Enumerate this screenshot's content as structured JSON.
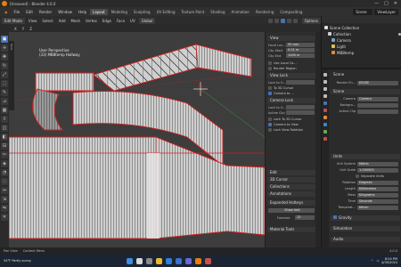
{
  "titlebar": {
    "title": "[Unsaved] - Blender 4.0.0",
    "min": "—",
    "max": "□",
    "close": "✕"
  },
  "menu": {
    "items": [
      "File",
      "Edit",
      "Render",
      "Window",
      "Help"
    ]
  },
  "workspaces": {
    "tabs": [
      "Layout",
      "Modeling",
      "Sculpting",
      "UV Editing",
      "Texture Paint",
      "Shading",
      "Animation",
      "Rendering",
      "Compositing",
      "Geometry Nodes",
      "Scripting"
    ],
    "active": "Layout"
  },
  "scene": {
    "name": "Scene",
    "view_layer": "ViewLayer"
  },
  "viewport_header": {
    "mode": "Edit Mode",
    "menus": [
      "View",
      "Select",
      "Add",
      "Mesh",
      "Vertex",
      "Edge",
      "Face",
      "UV"
    ],
    "orientation": "Global",
    "options": "Options"
  },
  "viewport_header2": {
    "items": [
      "X",
      "Y",
      "Z"
    ]
  },
  "tools_tab": "Tools",
  "viewport": {
    "view_name": "User Perspective",
    "object_name": "(33) MB8temp Hallway"
  },
  "toolbar": {
    "icons": [
      "select-box-icon",
      "cursor-icon",
      "move-icon",
      "rotate-icon",
      "scale-icon",
      "transform-icon",
      "annotate-icon",
      "measure-icon",
      "add-cube-icon",
      "extrude-icon",
      "inset-icon",
      "bevel-icon",
      "loopcut-icon",
      "knife-icon",
      "polybuild-icon",
      "spin-icon",
      "smooth-icon",
      "slide-icon",
      "shrink-icon",
      "shear-icon",
      "rip-icon"
    ]
  },
  "npanel": {
    "view_section": "View",
    "focal_length": {
      "label": "Focal Len...",
      "value": "50 mm"
    },
    "clip_start": {
      "label": "Clip Start",
      "value": "0.01 m"
    },
    "clip_end": {
      "label": "Clip End",
      "value": "1000 m"
    },
    "use_local_camera": "Use Local Ca...",
    "render_region": "Render Region",
    "view_lock_section": "View Lock",
    "lock_object": {
      "label": "Lock to O...",
      "value": ""
    },
    "lock_3d_cursor": "To 3D Cursor",
    "lock_camera": "Camera to ...",
    "camera_lock_section": "Camera Lock",
    "lock_to_object2": {
      "label": "Lock to O...",
      "value": ""
    },
    "active_clip": "Active Clip",
    "lock_3d_cursor2": "Lock To 3D Cursor",
    "camera_to_view": "Camera to View",
    "lock_view_rotation": "Lock View Rotation",
    "edit_section": "Edit",
    "sections_collapsed": [
      "3D Cursor",
      "Collections",
      "Annotations",
      "Expanded Hotkeys"
    ],
    "show_text": "Show text",
    "font_size_label": "Fontsize",
    "font_size": "12",
    "material_tools": "Material Tools"
  },
  "outliner": {
    "rows": [
      {
        "label": "Scene Collection",
        "icon_color": "#e0e0e0"
      },
      {
        "label": "Collection",
        "icon_color": "#cfcfcf"
      },
      {
        "label": "Camera",
        "icon_color": "#7aa2c8"
      },
      {
        "label": "Light",
        "icon_color": "#e0c050"
      },
      {
        "label": "MB8temp",
        "icon_color": "#e08a3a"
      }
    ]
  },
  "properties": {
    "scene_label": "Scene",
    "render_engine": {
      "label": "Render En...",
      "value": "EEVEE"
    },
    "scene_section": "Scene",
    "camera": {
      "label": "Camera",
      "value": "Camera"
    },
    "background": {
      "label": "Backgro...",
      "value": ""
    },
    "active_clip": {
      "label": "Active Clip",
      "value": ""
    },
    "units_section": "Units",
    "unit_system": {
      "label": "Unit System",
      "value": "Metric"
    },
    "unit_scale": {
      "label": "Unit Scale",
      "value": "1.000000"
    },
    "separate_units": "Separate Units",
    "rotation": {
      "label": "Rotation",
      "value": "Degrees"
    },
    "length": {
      "label": "Length",
      "value": "Millimeters"
    },
    "mass": {
      "label": "Mass",
      "value": "Kilograms"
    },
    "time": {
      "label": "Time",
      "value": "Seconds"
    },
    "temperature": {
      "label": "Temperat...",
      "value": "Kelvin"
    },
    "gravity_section": "Gravity",
    "simulation_section": "Simulation",
    "audio_section": "Audio"
  },
  "status": {
    "left": "Pan View",
    "middle": "Context Menu",
    "version": "4.0.0"
  },
  "taskbar": {
    "weather_temp": "54°F",
    "weather_text": "Partly sunny",
    "time": "6:04 PM",
    "date": "4/30/2024"
  },
  "colors": {
    "accent": "#4772b3",
    "edge_red": "#d22020",
    "orange": "#e87d0d"
  }
}
